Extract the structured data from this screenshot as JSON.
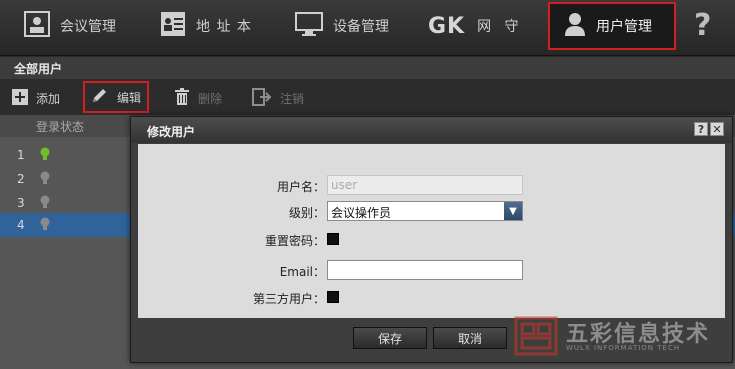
{
  "nav": {
    "items": [
      {
        "label": "会议管理",
        "icon": "meeting-icon"
      },
      {
        "label": "地 址 本",
        "icon": "address-book-icon"
      },
      {
        "label": "设备管理",
        "icon": "monitor-icon"
      },
      {
        "prefix": "GK",
        "label": "网   守",
        "icon": "gk-gatekeeper"
      },
      {
        "label": "用户管理",
        "icon": "user-icon",
        "active": true
      }
    ],
    "help": "?"
  },
  "breadcrumb": "全部用户",
  "toolbar": {
    "add": "添加",
    "edit": "编辑",
    "delete": "删除",
    "logout": "注销"
  },
  "table": {
    "column": "登录状态",
    "rows": [
      {
        "num": "1",
        "online": true
      },
      {
        "num": "2",
        "online": false
      },
      {
        "num": "3",
        "online": false
      },
      {
        "num": "4",
        "online": false,
        "selected": true
      }
    ]
  },
  "dialog": {
    "title": "修改用户",
    "help_glyph": "?",
    "close_glyph": "✕",
    "username_label": "用户名：",
    "username_value": "user",
    "level_label": "级别：",
    "level_value": "会议操作员",
    "reset_pwd_label": "重置密码：",
    "email_label": "Email：",
    "email_value": "",
    "third_party_label": "第三方用户：",
    "save": "保存",
    "cancel": "取消"
  },
  "watermark": {
    "text": "五彩信息技术",
    "sub": "WULX INFORMATION TECH"
  },
  "colors": {
    "highlight_border": "#d21f1f",
    "selected_row": "#31639b",
    "online_bulb": "#6fbf2a",
    "offline_bulb": "#8a8a8a"
  }
}
